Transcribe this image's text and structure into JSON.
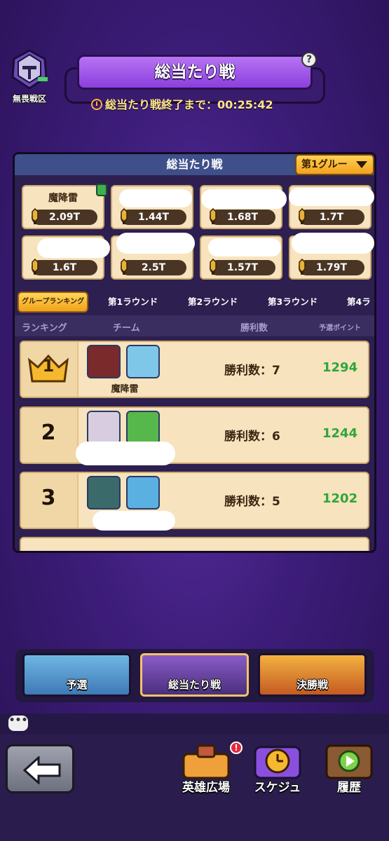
{
  "zone": {
    "label": "無畏戦区"
  },
  "header": {
    "title": "総当たり戦",
    "help_icon": "?",
    "timer_text": "総当たり戦終了まで：00:25:42"
  },
  "panel": {
    "title": "総当たり戦",
    "group_select": "第1グルー",
    "teams": [
      {
        "name": "魔降雷",
        "power": "2.09T"
      },
      {
        "name": "",
        "power": "1.44T"
      },
      {
        "name": "",
        "power": "1.68T"
      },
      {
        "name": "",
        "power": "1.7T"
      },
      {
        "name": "",
        "power": "1.6T"
      },
      {
        "name": "",
        "power": "2.5T"
      },
      {
        "name": "",
        "power": "1.57T"
      },
      {
        "name": "",
        "power": "1.79T"
      }
    ],
    "tabs": [
      "グループランキング",
      "第1ラウンド",
      "第2ラウンド",
      "第3ラウンド",
      "第4ラ"
    ],
    "columns": {
      "rank": "ランキング",
      "team": "チーム",
      "wins": "勝利数",
      "points": "予選ポイント"
    },
    "rows": [
      {
        "rank": "1",
        "name": "魔降雷",
        "wins": "勝利数：7",
        "points": "1294"
      },
      {
        "rank": "2",
        "name": "",
        "wins": "勝利数：6",
        "points": "1244"
      },
      {
        "rank": "3",
        "name": "",
        "wins": "勝利数：5",
        "points": "1202"
      }
    ]
  },
  "modes": {
    "qualifier": "予選",
    "round_robin": "総当たり戦",
    "finals": "決勝戦"
  },
  "footer": {
    "hero_plaza": "英雄広場",
    "schedule": "スケジュ",
    "history": "履歴",
    "notif": "!"
  },
  "colors": {
    "bg": "#3d1d7a",
    "title_purple": "#9b4fe6",
    "card": "#f7e3bd",
    "points_green": "#2ea63b",
    "gold": "#f2a11e"
  }
}
